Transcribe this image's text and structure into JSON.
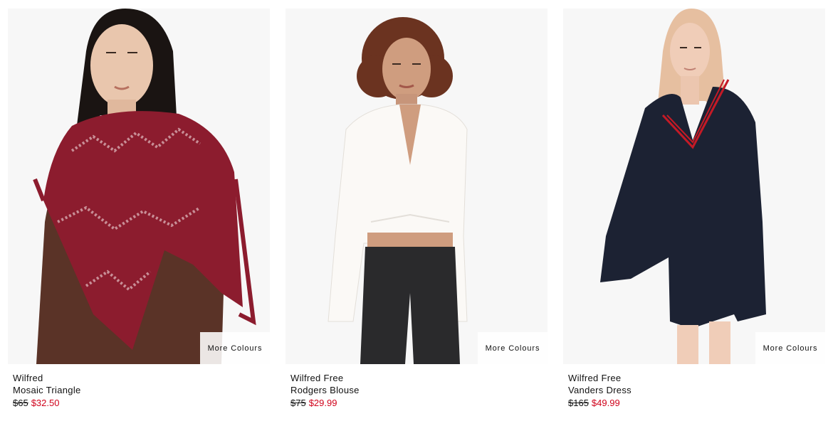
{
  "products": [
    {
      "brand": "Wilfred",
      "name": "Mosaic Triangle",
      "original_price": "$65",
      "sale_price": "$32.50",
      "more_colours": "More Colours"
    },
    {
      "brand": "Wilfred Free",
      "name": "Rodgers Blouse",
      "original_price": "$75",
      "sale_price": "$29.99",
      "more_colours": "More Colours"
    },
    {
      "brand": "Wilfred Free",
      "name": "Vanders Dress",
      "original_price": "$165",
      "sale_price": "$49.99",
      "more_colours": "More Colours"
    }
  ],
  "colors": {
    "sale_price": "#d0021b",
    "text": "#111111",
    "image_background": "#f6f6f6"
  }
}
